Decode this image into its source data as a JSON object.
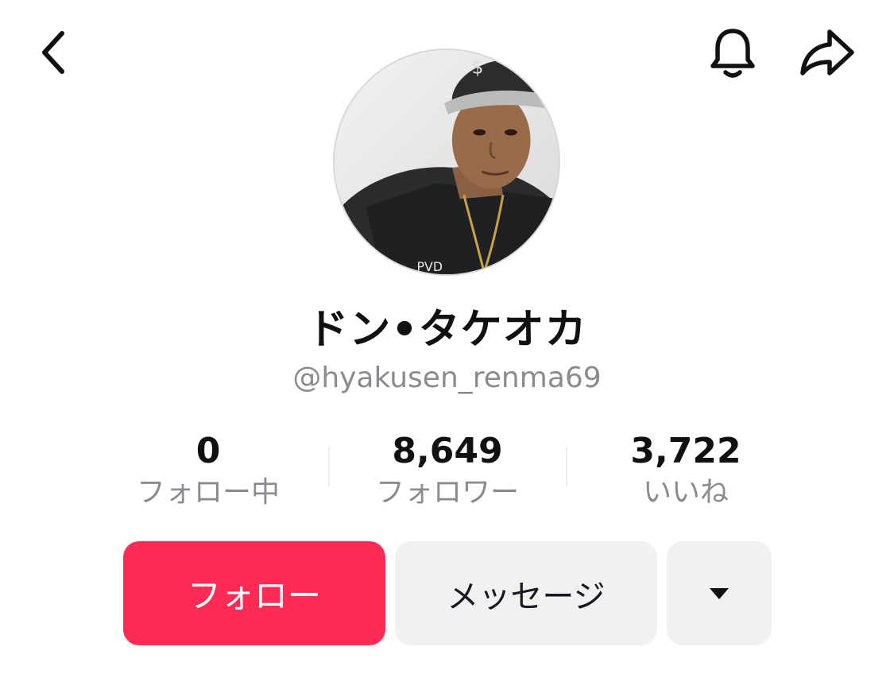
{
  "header": {
    "back_icon": "chevron-left-icon",
    "bell_icon": "bell-icon",
    "share_icon": "share-arrow-icon"
  },
  "profile": {
    "display_name": "ドン•タケオカ",
    "username": "@hyakusen_renma69"
  },
  "stats": [
    {
      "value": "0",
      "label": "フォロー中"
    },
    {
      "value": "8,649",
      "label": "フォロワー"
    },
    {
      "value": "3,722",
      "label": "いいね"
    }
  ],
  "actions": {
    "follow_label": "フォロー",
    "message_label": "メッセージ",
    "more_icon": "caret-down-icon"
  },
  "colors": {
    "follow_button": "#fe2c55",
    "secondary_button": "#f1f1f2",
    "muted_text": "#8a8b91"
  }
}
